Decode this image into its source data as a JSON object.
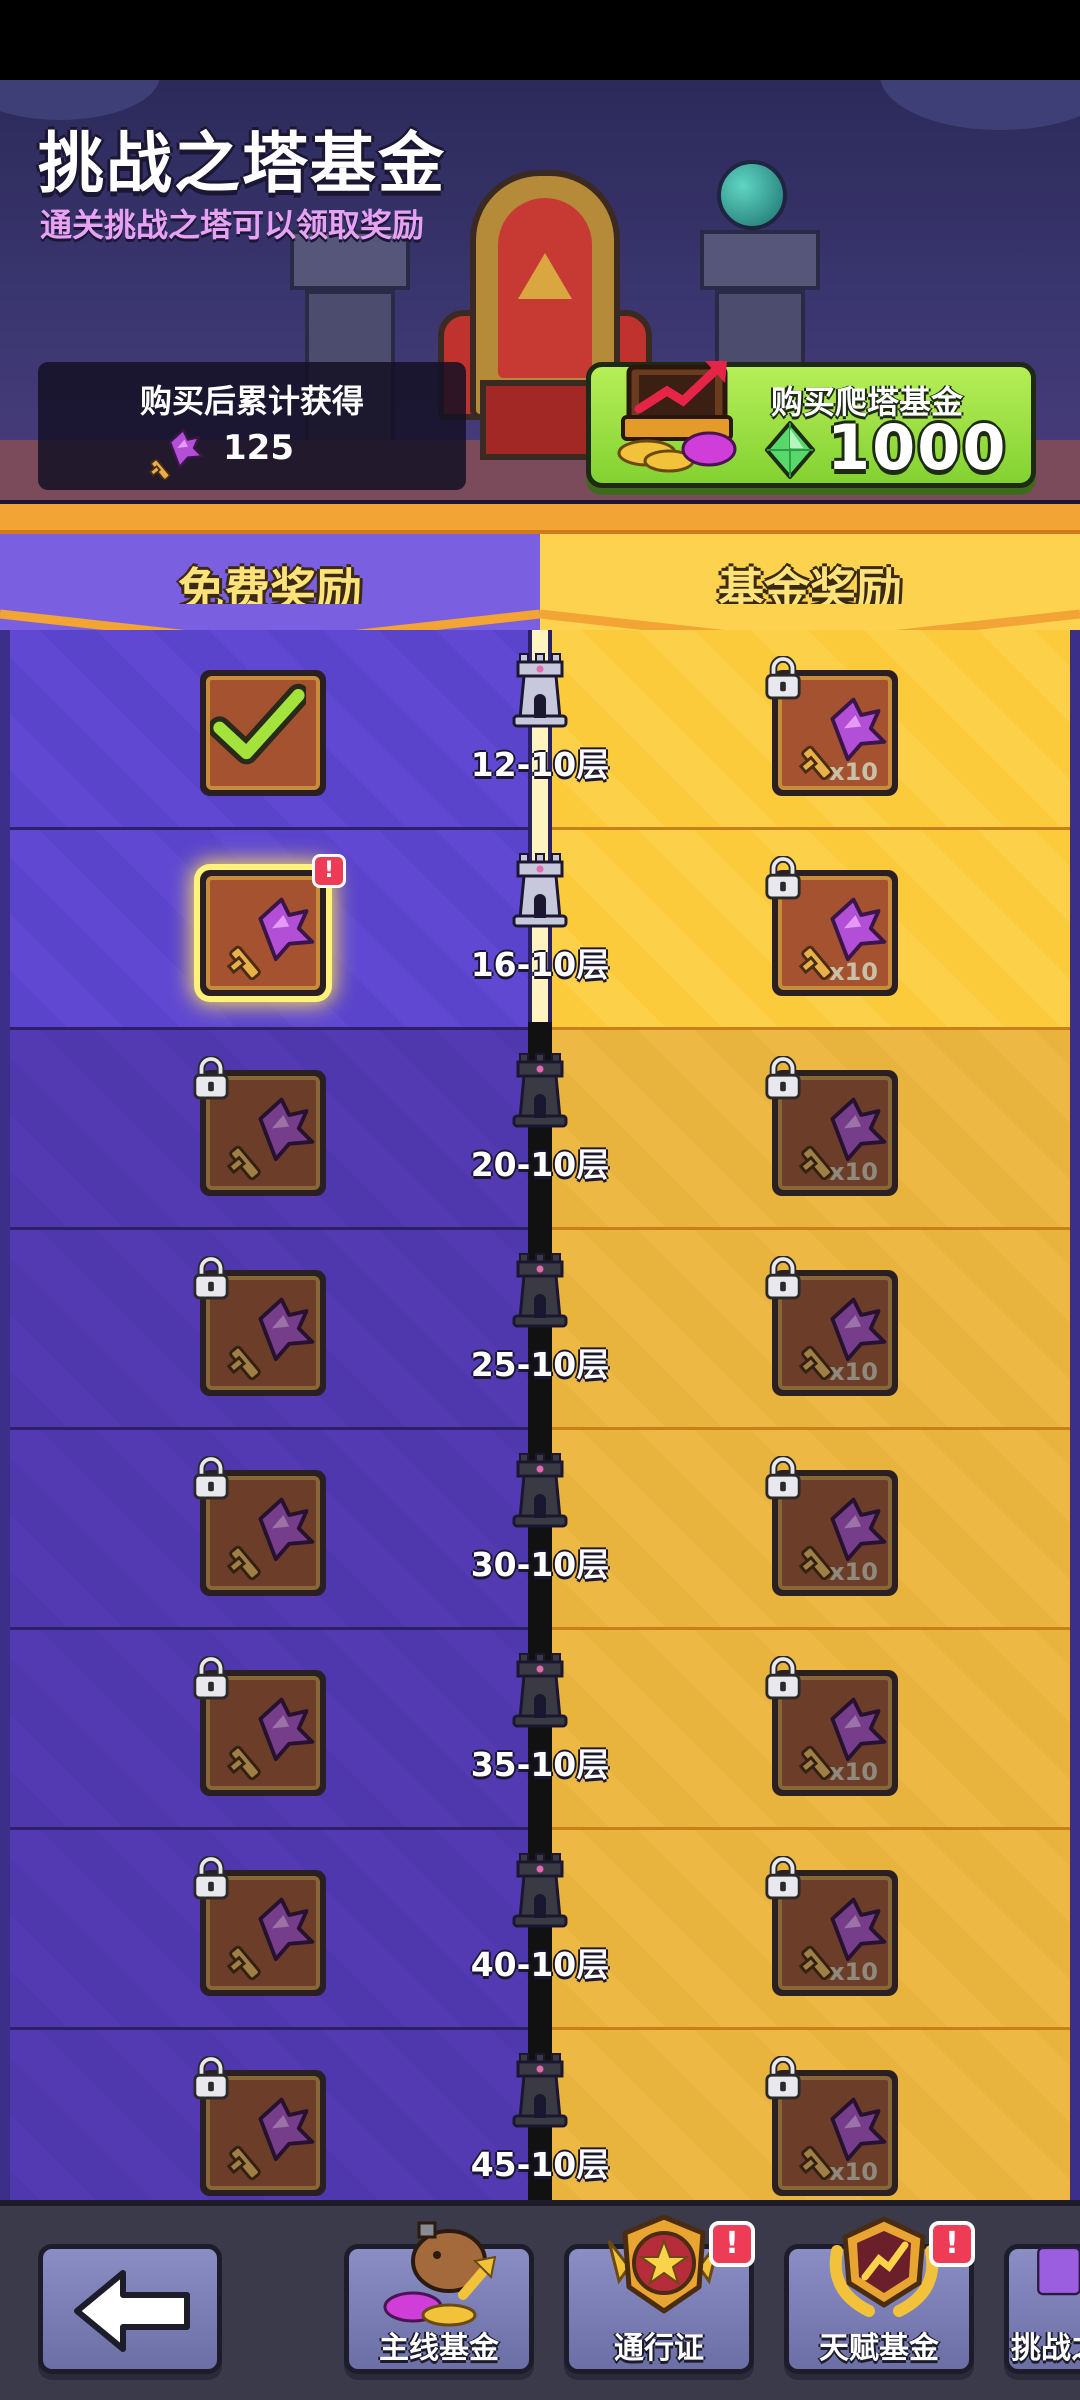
{
  "header": {
    "title": "挑战之塔基金",
    "subtitle": "通关挑战之塔可以领取奖励",
    "accumulated": {
      "label": "购买后累计获得",
      "value": "125",
      "icon": "key-icon"
    },
    "buy": {
      "label": "购买爬塔基金",
      "price": "1000",
      "currency_icon": "green-gem-icon"
    }
  },
  "columns": {
    "free_label": "免费奖励",
    "fund_label": "基金奖励"
  },
  "rows": [
    {
      "floor": "12-10层",
      "free_state": "claimed",
      "fund_qty": "x10"
    },
    {
      "floor": "16-10层",
      "free_state": "claimable",
      "fund_qty": "x10"
    },
    {
      "floor": "20-10层",
      "free_state": "locked",
      "fund_qty": "x10"
    },
    {
      "floor": "25-10层",
      "free_state": "locked",
      "fund_qty": "x10"
    },
    {
      "floor": "30-10层",
      "free_state": "locked",
      "fund_qty": "x10"
    },
    {
      "floor": "35-10层",
      "free_state": "locked",
      "fund_qty": "x10"
    },
    {
      "floor": "40-10层",
      "free_state": "locked",
      "fund_qty": "x10"
    },
    {
      "floor": "45-10层",
      "free_state": "locked",
      "fund_qty": "x10"
    }
  ],
  "badges": {
    "alert": "!"
  },
  "bottom_nav": {
    "back_icon": "back-arrow-icon",
    "tabs": [
      {
        "label": "主线基金",
        "icon": "capybara-coins-icon",
        "badge": false
      },
      {
        "label": "通行证",
        "icon": "star-shield-icon",
        "badge": true
      },
      {
        "label": "天赋基金",
        "icon": "laurel-arrow-icon",
        "badge": true
      },
      {
        "label": "挑战之",
        "icon": "tower-icon",
        "badge": false
      }
    ]
  },
  "colors": {
    "free_column": "#5b44cc",
    "fund_column": "#fccb3b",
    "buy_button": "#9be044",
    "alert_badge": "#ee3c57"
  }
}
